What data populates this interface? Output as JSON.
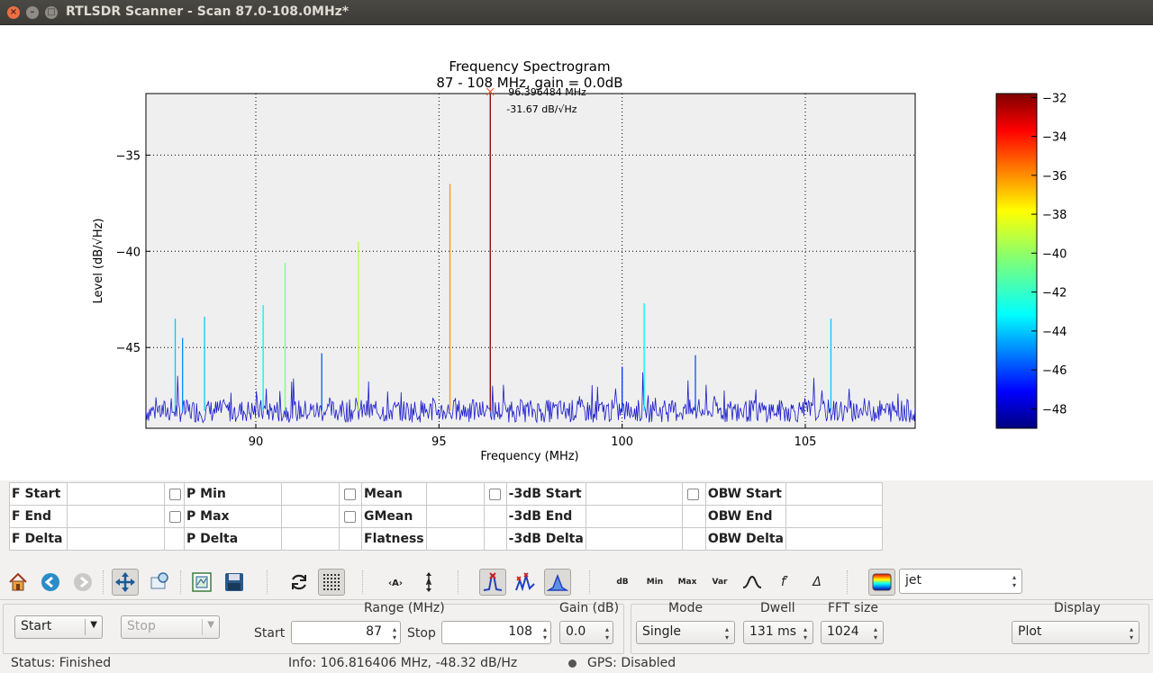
{
  "window": {
    "title": "RTLSDR Scanner - Scan 87.0-108.0MHz*"
  },
  "chart_data": {
    "type": "line",
    "title": "Frequency Spectrogram",
    "subtitle": "87 - 108 MHz, gain = 0.0dB",
    "xlabel": "Frequency (MHz)",
    "ylabel": "Level (dB/√Hz)",
    "xlim": [
      87,
      108
    ],
    "ylim": [
      -49.2,
      -31.8
    ],
    "xticks": [
      90,
      95,
      100,
      105
    ],
    "yticks": [
      -35,
      -40,
      -45
    ],
    "grid": true,
    "noise_floor": -48.3,
    "peaks": [
      {
        "f": 87.8,
        "level": -43.5
      },
      {
        "f": 88.0,
        "level": -44.5
      },
      {
        "f": 88.6,
        "level": -43.4
      },
      {
        "f": 90.2,
        "level": -42.8
      },
      {
        "f": 90.8,
        "level": -40.6
      },
      {
        "f": 91.8,
        "level": -45.3
      },
      {
        "f": 92.8,
        "level": -39.5
      },
      {
        "f": 95.3,
        "level": -36.5
      },
      {
        "f": 96.4,
        "level": -31.7
      },
      {
        "f": 100.0,
        "level": -46.0
      },
      {
        "f": 100.6,
        "level": -42.7
      },
      {
        "f": 102.0,
        "level": -45.4
      },
      {
        "f": 105.7,
        "level": -43.5
      }
    ],
    "annotation": {
      "freq_label": "96.396484 MHz",
      "level_label": "-31.67 dB/√Hz"
    },
    "colorbar": {
      "map": "jet",
      "range": [
        -49,
        -31.8
      ],
      "ticks": [
        -32,
        -34,
        -36,
        -38,
        -40,
        -42,
        -44,
        -46,
        -48
      ]
    }
  },
  "measure": {
    "col1": [
      "F Start",
      "F End",
      "F Delta"
    ],
    "col2": [
      "P Min",
      "P Max",
      "P Delta"
    ],
    "col3": [
      "Mean",
      "GMean",
      "Flatness"
    ],
    "col4": [
      "-3dB Start",
      "-3dB End",
      "-3dB Delta"
    ],
    "col5": [
      "OBW Start",
      "OBW End",
      "OBW Delta"
    ]
  },
  "toolbar": {
    "db_label": "dB",
    "min_label": "Min",
    "max_label": "Max",
    "var_label": "Var",
    "fprime_label": "f′",
    "delta_label": "Δ",
    "colormap": "jet",
    "icons": [
      "home-icon",
      "back-icon",
      "forward-icon",
      "pan-icon",
      "zoom-icon",
      "subplots-icon",
      "save-icon",
      "refresh-icon",
      "grid-icon",
      "x-range-icon",
      "y-range-icon",
      "peak-icon",
      "peaks-icon",
      "fill-icon",
      "smooth-icon",
      "colormap-icon"
    ]
  },
  "controls": {
    "start_button": "Start",
    "stop_button": "Stop",
    "range_title": "Range (MHz)",
    "start_label": "Start",
    "start_value": "87",
    "stop_label": "Stop",
    "stop_value": "108",
    "gain_title": "Gain (dB)",
    "gain_value": "0.0",
    "mode_title": "Mode",
    "mode_value": "Single",
    "dwell_title": "Dwell",
    "dwell_value": "131 ms",
    "fft_title": "FFT size",
    "fft_value": "1024",
    "display_title": "Display",
    "display_value": "Plot"
  },
  "status": {
    "status_text": "Status: Finished",
    "info_text": "Info: 106.816406 MHz, -48.32 dB/Hz",
    "gps_text": "GPS: Disabled"
  },
  "colors": {
    "accent": "#4a7fc1",
    "close": "#ef6e43"
  }
}
